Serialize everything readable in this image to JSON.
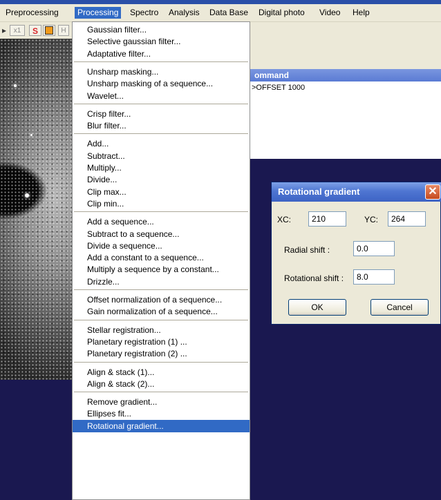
{
  "menubar": {
    "items": [
      {
        "label": "Preprocessing"
      },
      {
        "label": "Processing"
      },
      {
        "label": "Spectro"
      },
      {
        "label": "Analysis"
      },
      {
        "label": "Data Base"
      },
      {
        "label": "Digital photo"
      },
      {
        "label": "Video"
      },
      {
        "label": "Help"
      }
    ],
    "active": "Processing"
  },
  "toolbar": {
    "button_x1": "x1",
    "button_h": "H"
  },
  "processing_menu": {
    "groups": [
      [
        "Gaussian filter...",
        "Selective gaussian filter...",
        "Adaptative filter..."
      ],
      [
        "Unsharp masking...",
        "Unsharp masking of a sequence...",
        "Wavelet..."
      ],
      [
        "Crisp filter...",
        "Blur filter..."
      ],
      [
        "Add...",
        "Subtract...",
        "Multiply...",
        "Divide...",
        "Clip max...",
        "Clip min..."
      ],
      [
        "Add a sequence...",
        "Subtract to a sequence...",
        "Divide a sequence...",
        "Add a constant to a sequence...",
        "Multiply a sequence by a constant...",
        "Drizzle..."
      ],
      [
        "Offset normalization of a sequence...",
        "Gain normalization of a sequence..."
      ],
      [
        "Stellar registration...",
        "Planetary registration (1) ...",
        "Planetary registration (2) ..."
      ],
      [
        "Align & stack (1)...",
        "Align & stack (2)..."
      ],
      [
        "Remove gradient...",
        "Ellipses fit...",
        "Rotational gradient..."
      ]
    ],
    "selected": "Rotational gradient..."
  },
  "command_panel": {
    "title": "ommand",
    "line": ">OFFSET 1000"
  },
  "dialog": {
    "title": "Rotational gradient",
    "close_glyph": "✕",
    "xc_label": "XC:",
    "xc_value": "210",
    "yc_label": "YC:",
    "yc_value": "264",
    "radial_label": "Radial shift :",
    "radial_value": "0.0",
    "rotational_label": "Rotational shift :",
    "rotational_value": "8.0",
    "ok_label": "OK",
    "cancel_label": "Cancel"
  },
  "colors": {
    "menu_highlight": "#316ac5",
    "desktop_bg": "#1a1850",
    "dialog_title": "#4f76d2",
    "close_button": "#c64b1f"
  },
  "icons": [
    "toolbar-arrow-icon",
    "toolbar-red-s-icon",
    "toolbar-orange-square-icon",
    "close-icon"
  ]
}
